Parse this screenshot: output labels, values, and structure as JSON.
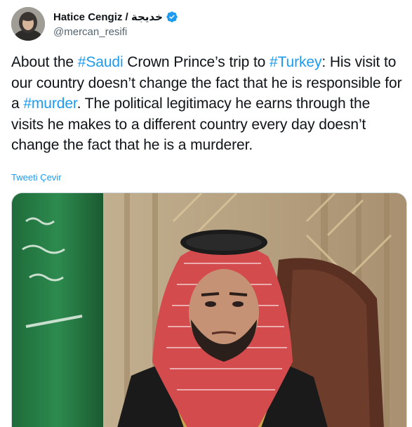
{
  "author": {
    "display_name": "Hatice Cengiz / خديجة",
    "handle": "@mercan_resifi",
    "verified_icon": "verified-badge-icon",
    "avatar_icon": "profile-photo"
  },
  "tweet": {
    "segments": [
      {
        "text": "About the ",
        "hashtag": false
      },
      {
        "text": "#Saudi",
        "hashtag": true
      },
      {
        "text": " Crown Prince’s trip to ",
        "hashtag": false
      },
      {
        "text": "#Turkey",
        "hashtag": true
      },
      {
        "text": ": His visit  to our country doesn’t change the fact that he is responsible for a ",
        "hashtag": false
      },
      {
        "text": "#murder",
        "hashtag": true
      },
      {
        "text": ". The political legitimacy he earns through the visits he makes to a different country every day doesn’t change the fact that he is a murderer.",
        "hashtag": false
      }
    ],
    "translate_label": "Tweeti Çevir",
    "media_description_icon": "tweet-photo"
  },
  "colors": {
    "link": "#1d9bf0",
    "text": "#0f1419",
    "secondary": "#536471"
  }
}
